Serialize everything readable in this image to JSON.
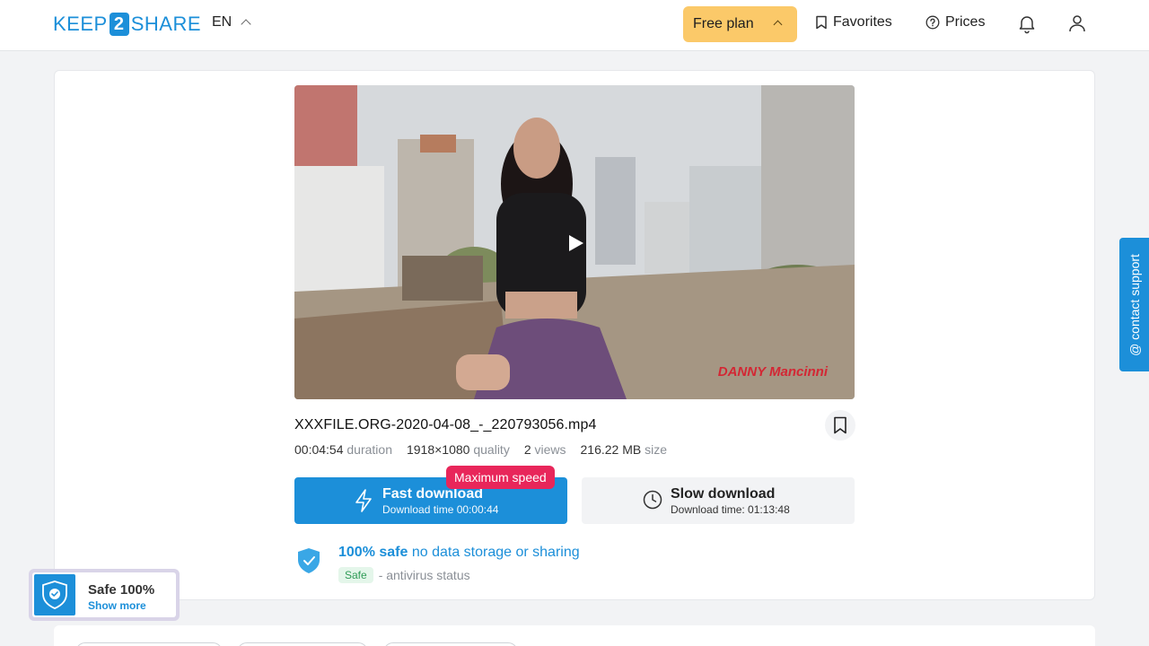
{
  "header": {
    "logo": {
      "part1": "KEEP",
      "num": "2",
      "part2": "SHARE"
    },
    "language": "EN",
    "plan_label": "Free plan",
    "favorites_label": "Favorites",
    "prices_label": "Prices"
  },
  "file": {
    "name": "XXXFILE.ORG-2020-04-08_-_220793056.mp4",
    "duration_value": "00:04:54",
    "duration_label": "duration",
    "quality_value": "1918×1080",
    "quality_label": "quality",
    "views_value": "2",
    "views_label": "views",
    "size_value": "216.22 MB",
    "size_label": "size"
  },
  "video": {
    "watermark": "DANNY Mancinni"
  },
  "download": {
    "fast_title": "Fast download",
    "fast_time": "Download time 00:00:44",
    "max_speed_badge": "Maximum speed",
    "slow_title": "Slow download",
    "slow_time": "Download time: 01:13:48"
  },
  "safety": {
    "bold": "100% safe",
    "rest": "no data storage or sharing",
    "tag": "Safe",
    "status": "- antivirus status"
  },
  "support_label": "@ contact support",
  "safe_badge": {
    "title": "Safe 100%",
    "link": "Show more"
  },
  "colors": {
    "accent": "#1c8fd9",
    "plan": "#fbc969",
    "badge_red": "#e8265a",
    "safe_green": "#2f9b56"
  }
}
